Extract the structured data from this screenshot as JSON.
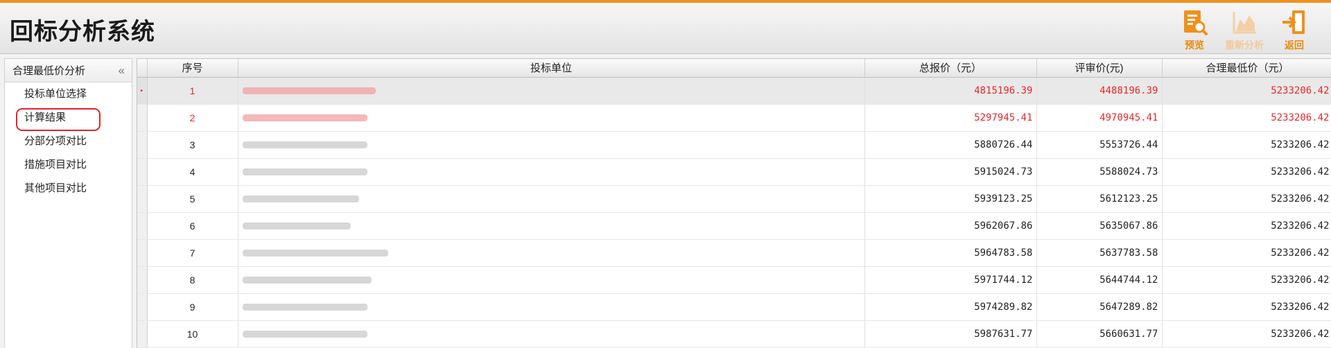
{
  "app": {
    "title": "回标分析系统"
  },
  "toolbar": {
    "buttons": [
      {
        "label": "预览",
        "icon": "preview-icon",
        "enabled": true
      },
      {
        "label": "重新分析",
        "icon": "chart-icon",
        "enabled": false
      },
      {
        "label": "返回",
        "icon": "exit-icon",
        "enabled": true
      }
    ]
  },
  "sidebar": {
    "title": "合理最低价分析",
    "collapse_glyph": "«",
    "items": [
      {
        "label": "投标单位选择"
      },
      {
        "label": "计算结果",
        "active": true
      },
      {
        "label": "分部分项对比"
      },
      {
        "label": "措施项目对比"
      },
      {
        "label": "其他项目对比"
      }
    ]
  },
  "table": {
    "row_indicator": "▸",
    "columns": [
      "序号",
      "投标单位",
      "总报价（元）",
      "评审价(元)",
      "合理最低价（元）"
    ],
    "rows": [
      {
        "seq": "1",
        "unit": "",
        "blur_width": 0.64,
        "total": "4815196.39",
        "review": "4488196.39",
        "lowest": "5233206.42",
        "highlight": true
      },
      {
        "seq": "2",
        "unit": "",
        "blur_width": 0.6,
        "total": "5297945.41",
        "review": "4970945.41",
        "lowest": "5233206.42",
        "highlight": true
      },
      {
        "seq": "3",
        "unit": "",
        "blur_width": 0.6,
        "total": "5880726.44",
        "review": "5553726.44",
        "lowest": "5233206.42"
      },
      {
        "seq": "4",
        "unit": "",
        "blur_width": 0.6,
        "total": "5915024.73",
        "review": "5588024.73",
        "lowest": "5233206.42"
      },
      {
        "seq": "5",
        "unit": "",
        "blur_width": 0.56,
        "total": "5939123.25",
        "review": "5612123.25",
        "lowest": "5233206.42"
      },
      {
        "seq": "6",
        "unit": "",
        "blur_width": 0.52,
        "total": "5962067.86",
        "review": "5635067.86",
        "lowest": "5233206.42"
      },
      {
        "seq": "7",
        "unit": "",
        "blur_width": 0.7,
        "total": "5964783.58",
        "review": "5637783.58",
        "lowest": "5233206.42"
      },
      {
        "seq": "8",
        "unit": "",
        "blur_width": 0.62,
        "total": "5971744.12",
        "review": "5644744.12",
        "lowest": "5233206.42"
      },
      {
        "seq": "9",
        "unit": "",
        "blur_width": 0.6,
        "total": "5974289.82",
        "review": "5647289.82",
        "lowest": "5233206.42"
      },
      {
        "seq": "10",
        "unit": "",
        "blur_width": 0.6,
        "total": "5987631.77",
        "review": "5660631.77",
        "lowest": "5233206.42"
      }
    ]
  },
  "colors": {
    "accent": "#f0901a",
    "highlight_text": "#e8262b",
    "button_label": "#e88a10"
  }
}
